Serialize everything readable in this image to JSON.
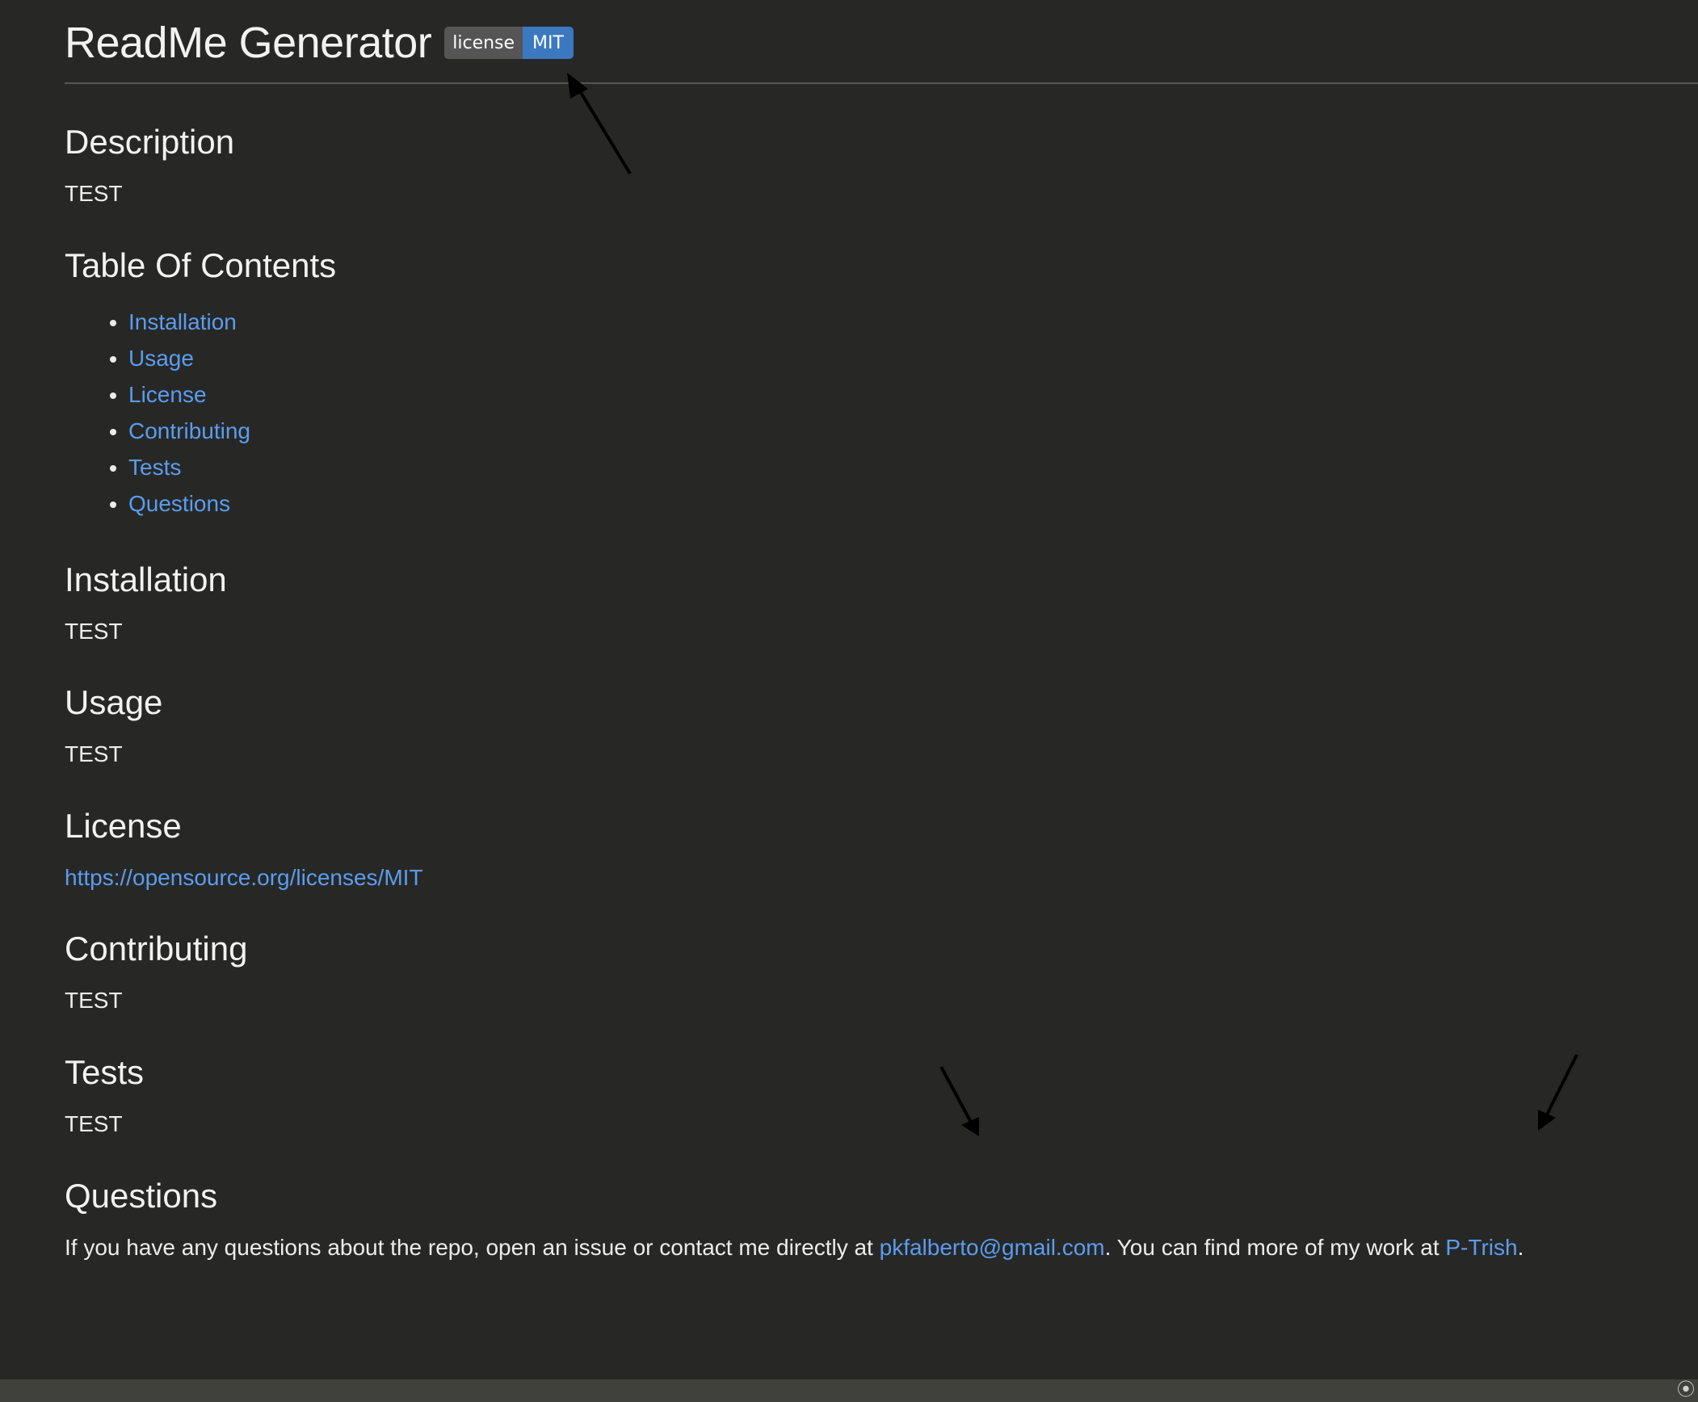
{
  "header": {
    "title": "ReadMe Generator",
    "badge_left": "license",
    "badge_right": "MIT"
  },
  "sections": {
    "description": {
      "heading": "Description",
      "body": "TEST"
    },
    "toc": {
      "heading": "Table Of Contents",
      "items": [
        "Installation",
        "Usage",
        "License",
        "Contributing",
        "Tests",
        "Questions"
      ]
    },
    "installation": {
      "heading": "Installation",
      "body": "TEST"
    },
    "usage": {
      "heading": "Usage",
      "body": "TEST"
    },
    "license": {
      "heading": "License",
      "link": "https://opensource.org/licenses/MIT"
    },
    "contributing": {
      "heading": "Contributing",
      "body": "TEST"
    },
    "tests": {
      "heading": "Tests",
      "body": "TEST"
    },
    "questions": {
      "heading": "Questions",
      "text_before": "If you have any questions about the repo, open an issue or contact me directly at ",
      "email": "pkfalberto@gmail.com",
      "text_middle": ". You can find more of my work at ",
      "github": "P-Trish",
      "text_after": "."
    }
  },
  "status_bar": {
    "icon": "broadcast-icon"
  },
  "colors": {
    "background": "#272825",
    "link": "#5b9cf0",
    "badge_left": "#555555",
    "badge_right": "#3b78c0"
  }
}
